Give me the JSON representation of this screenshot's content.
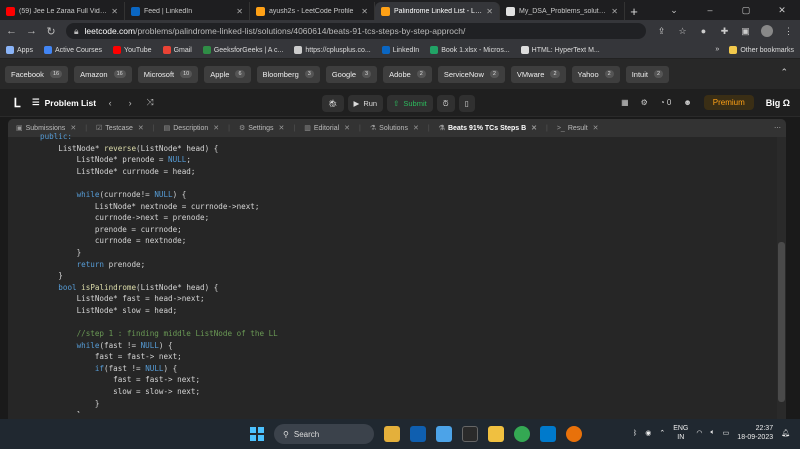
{
  "browser": {
    "tabs": [
      {
        "title": "(59) Jee Le Zaraa Full Video S",
        "color": "#ff0000"
      },
      {
        "title": "Feed | LinkedIn",
        "color": "#0a66c2"
      },
      {
        "title": "ayush2s - LeetCode Profile",
        "color": "#ffa116"
      },
      {
        "title": "Palindrome Linked List - Leet",
        "color": "#ffa116",
        "active": true
      },
      {
        "title": "My_DSA_Problems_solution/",
        "color": "#e0e0e0"
      }
    ],
    "new_tab": "+",
    "url_domain": "leetcode.com",
    "url_path": "/problems/palindrome-linked-list/solutions/4060614/beats-91-tcs-steps-by-step-approch/",
    "bookmarks": [
      {
        "label": "Apps",
        "color": "#8ab4f8"
      },
      {
        "label": "Active Courses",
        "color": "#4285f4"
      },
      {
        "label": "YouTube",
        "color": "#ff0000"
      },
      {
        "label": "Gmail",
        "color": "#ea4335"
      },
      {
        "label": "GeeksforGeeks | A c...",
        "color": "#2f8d46"
      },
      {
        "label": "https://cplusplus.co...",
        "color": "#cccccc"
      },
      {
        "label": "LinkedIn",
        "color": "#0a66c2"
      },
      {
        "label": "Book 1.xlsx - Micros...",
        "color": "#21a366"
      },
      {
        "label": "HTML: HyperText M...",
        "color": "#dddddd"
      }
    ],
    "bookmarks_more": "»",
    "other_bookmarks": "Other bookmarks"
  },
  "companies": [
    {
      "name": "Facebook",
      "count": "16"
    },
    {
      "name": "Amazon",
      "count": "16"
    },
    {
      "name": "Microsoft",
      "count": "10"
    },
    {
      "name": "Apple",
      "count": "6"
    },
    {
      "name": "Bloomberg",
      "count": "3"
    },
    {
      "name": "Google",
      "count": "3"
    },
    {
      "name": "Adobe",
      "count": "2"
    },
    {
      "name": "ServiceNow",
      "count": "2"
    },
    {
      "name": "VMware",
      "count": "2"
    },
    {
      "name": "Yahoo",
      "count": "2"
    },
    {
      "name": "Intuit",
      "count": "2"
    }
  ],
  "header": {
    "problem_list": "Problem List",
    "run": "Run",
    "submit": "Submit",
    "streak": "0",
    "premium": "Premium",
    "bigo": "Big Ω"
  },
  "panel_tabs": [
    {
      "label": "Submissions",
      "icon": "▣"
    },
    {
      "label": "Testcase",
      "icon": "☑"
    },
    {
      "label": "Description",
      "icon": "▤"
    },
    {
      "label": "Settings",
      "icon": "⚙"
    },
    {
      "label": "Editorial",
      "icon": "▥"
    },
    {
      "label": "Solutions",
      "icon": "⚗"
    },
    {
      "label": "Beats 91% TCs Steps B",
      "icon": "⚗",
      "active": true
    },
    {
      "label": "Result",
      "icon": ">_"
    }
  ],
  "code_lines": [
    "public:",
    "    ListNode* reverse(ListNode* head) {",
    "        ListNode* prenode = NULL;",
    "        ListNode* currnode = head;",
    "",
    "        while(currnode!= NULL) {",
    "            ListNode* nextnode = currnode->next;",
    "            currnode->next = prenode;",
    "            prenode = currnode;",
    "            currnode = nextnode;",
    "        }",
    "        return prenode;",
    "    }",
    "    bool isPalindrome(ListNode* head) {",
    "        ListNode* fast = head->next;",
    "        ListNode* slow = head;",
    "",
    "        //step 1 : finding middle ListNode of the LL",
    "        while(fast != NULL) {",
    "            fast = fast-> next;",
    "            if(fast != NULL) {",
    "                fast = fast-> next;",
    "                slow = slow-> next;",
    "            }",
    "        }"
  ],
  "taskbar": {
    "search": "Search",
    "lang_top": "ENG",
    "lang_bottom": "IN",
    "time": "22:37",
    "date": "18-09-2023"
  }
}
